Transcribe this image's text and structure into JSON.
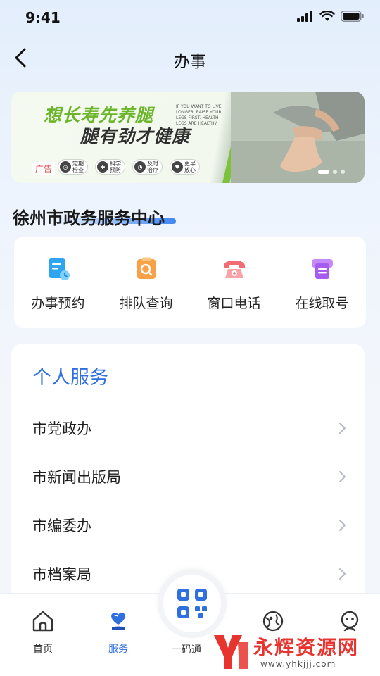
{
  "status_bar": {
    "time": "9:41"
  },
  "nav": {
    "title": "办事"
  },
  "banner": {
    "headline": "想长寿先养腿",
    "subheadline": "腿有劲才健康",
    "english": "IF YOU WANT TO LIVE LONGER, RAISE YOUR LEGS FIRST. HEALTH LEGS ARE HEALTHY",
    "ad_tag": "广告",
    "badges": [
      {
        "line1": "定期",
        "line2": "检查"
      },
      {
        "line1": "科学",
        "line2": "预防"
      },
      {
        "line1": "及时",
        "line2": "治疗"
      },
      {
        "line1": "更早",
        "line2": "放心"
      }
    ],
    "slide_active": 1,
    "slide_count": 3
  },
  "center": {
    "title": "徐州市政务服务中心"
  },
  "quick_actions": [
    {
      "label": "办事预约",
      "icon": "appointment-icon"
    },
    {
      "label": "排队查询",
      "icon": "queue-search-icon"
    },
    {
      "label": "窗口电话",
      "icon": "phone-icon"
    },
    {
      "label": "在线取号",
      "icon": "ticket-icon"
    }
  ],
  "services": {
    "title": "个人服务",
    "items": [
      "市党政办",
      "市新闻出版局",
      "市编委办",
      "市档案局"
    ]
  },
  "tabbar": {
    "items": [
      {
        "label": "首页",
        "icon": "home-icon",
        "active": false
      },
      {
        "label": "服务",
        "icon": "service-heart-icon",
        "active": true
      },
      {
        "label": "一码通",
        "icon": "qr-code-icon",
        "active": false
      },
      {
        "label": "",
        "icon": "map-icon",
        "active": false
      },
      {
        "label": "",
        "icon": "profile-icon",
        "active": false
      }
    ]
  },
  "watermark": {
    "text": "永辉资源网",
    "url": "www.yhkjjj.com"
  },
  "colors": {
    "accent": "#2f6fe0",
    "ad_red": "#e0464e",
    "banner_green": "#6ab52a"
  }
}
